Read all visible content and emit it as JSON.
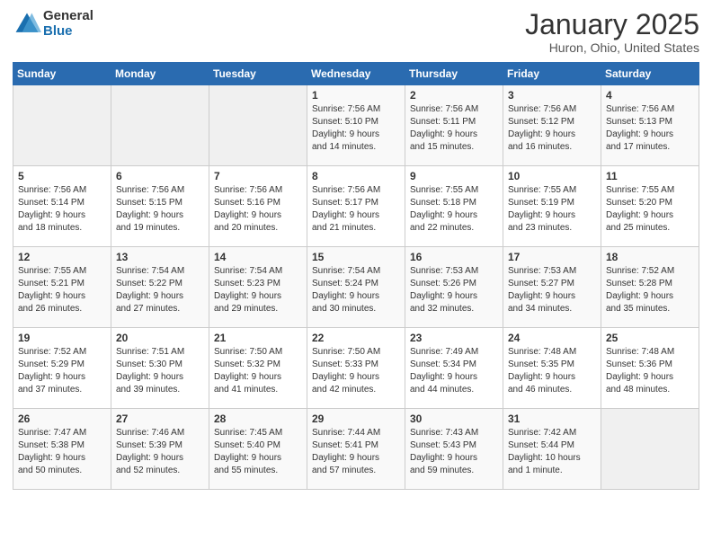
{
  "logo": {
    "general": "General",
    "blue": "Blue"
  },
  "header": {
    "month_year": "January 2025",
    "location": "Huron, Ohio, United States"
  },
  "weekdays": [
    "Sunday",
    "Monday",
    "Tuesday",
    "Wednesday",
    "Thursday",
    "Friday",
    "Saturday"
  ],
  "weeks": [
    [
      {
        "day": "",
        "detail": ""
      },
      {
        "day": "",
        "detail": ""
      },
      {
        "day": "",
        "detail": ""
      },
      {
        "day": "1",
        "detail": "Sunrise: 7:56 AM\nSunset: 5:10 PM\nDaylight: 9 hours\nand 14 minutes."
      },
      {
        "day": "2",
        "detail": "Sunrise: 7:56 AM\nSunset: 5:11 PM\nDaylight: 9 hours\nand 15 minutes."
      },
      {
        "day": "3",
        "detail": "Sunrise: 7:56 AM\nSunset: 5:12 PM\nDaylight: 9 hours\nand 16 minutes."
      },
      {
        "day": "4",
        "detail": "Sunrise: 7:56 AM\nSunset: 5:13 PM\nDaylight: 9 hours\nand 17 minutes."
      }
    ],
    [
      {
        "day": "5",
        "detail": "Sunrise: 7:56 AM\nSunset: 5:14 PM\nDaylight: 9 hours\nand 18 minutes."
      },
      {
        "day": "6",
        "detail": "Sunrise: 7:56 AM\nSunset: 5:15 PM\nDaylight: 9 hours\nand 19 minutes."
      },
      {
        "day": "7",
        "detail": "Sunrise: 7:56 AM\nSunset: 5:16 PM\nDaylight: 9 hours\nand 20 minutes."
      },
      {
        "day": "8",
        "detail": "Sunrise: 7:56 AM\nSunset: 5:17 PM\nDaylight: 9 hours\nand 21 minutes."
      },
      {
        "day": "9",
        "detail": "Sunrise: 7:55 AM\nSunset: 5:18 PM\nDaylight: 9 hours\nand 22 minutes."
      },
      {
        "day": "10",
        "detail": "Sunrise: 7:55 AM\nSunset: 5:19 PM\nDaylight: 9 hours\nand 23 minutes."
      },
      {
        "day": "11",
        "detail": "Sunrise: 7:55 AM\nSunset: 5:20 PM\nDaylight: 9 hours\nand 25 minutes."
      }
    ],
    [
      {
        "day": "12",
        "detail": "Sunrise: 7:55 AM\nSunset: 5:21 PM\nDaylight: 9 hours\nand 26 minutes."
      },
      {
        "day": "13",
        "detail": "Sunrise: 7:54 AM\nSunset: 5:22 PM\nDaylight: 9 hours\nand 27 minutes."
      },
      {
        "day": "14",
        "detail": "Sunrise: 7:54 AM\nSunset: 5:23 PM\nDaylight: 9 hours\nand 29 minutes."
      },
      {
        "day": "15",
        "detail": "Sunrise: 7:54 AM\nSunset: 5:24 PM\nDaylight: 9 hours\nand 30 minutes."
      },
      {
        "day": "16",
        "detail": "Sunrise: 7:53 AM\nSunset: 5:26 PM\nDaylight: 9 hours\nand 32 minutes."
      },
      {
        "day": "17",
        "detail": "Sunrise: 7:53 AM\nSunset: 5:27 PM\nDaylight: 9 hours\nand 34 minutes."
      },
      {
        "day": "18",
        "detail": "Sunrise: 7:52 AM\nSunset: 5:28 PM\nDaylight: 9 hours\nand 35 minutes."
      }
    ],
    [
      {
        "day": "19",
        "detail": "Sunrise: 7:52 AM\nSunset: 5:29 PM\nDaylight: 9 hours\nand 37 minutes."
      },
      {
        "day": "20",
        "detail": "Sunrise: 7:51 AM\nSunset: 5:30 PM\nDaylight: 9 hours\nand 39 minutes."
      },
      {
        "day": "21",
        "detail": "Sunrise: 7:50 AM\nSunset: 5:32 PM\nDaylight: 9 hours\nand 41 minutes."
      },
      {
        "day": "22",
        "detail": "Sunrise: 7:50 AM\nSunset: 5:33 PM\nDaylight: 9 hours\nand 42 minutes."
      },
      {
        "day": "23",
        "detail": "Sunrise: 7:49 AM\nSunset: 5:34 PM\nDaylight: 9 hours\nand 44 minutes."
      },
      {
        "day": "24",
        "detail": "Sunrise: 7:48 AM\nSunset: 5:35 PM\nDaylight: 9 hours\nand 46 minutes."
      },
      {
        "day": "25",
        "detail": "Sunrise: 7:48 AM\nSunset: 5:36 PM\nDaylight: 9 hours\nand 48 minutes."
      }
    ],
    [
      {
        "day": "26",
        "detail": "Sunrise: 7:47 AM\nSunset: 5:38 PM\nDaylight: 9 hours\nand 50 minutes."
      },
      {
        "day": "27",
        "detail": "Sunrise: 7:46 AM\nSunset: 5:39 PM\nDaylight: 9 hours\nand 52 minutes."
      },
      {
        "day": "28",
        "detail": "Sunrise: 7:45 AM\nSunset: 5:40 PM\nDaylight: 9 hours\nand 55 minutes."
      },
      {
        "day": "29",
        "detail": "Sunrise: 7:44 AM\nSunset: 5:41 PM\nDaylight: 9 hours\nand 57 minutes."
      },
      {
        "day": "30",
        "detail": "Sunrise: 7:43 AM\nSunset: 5:43 PM\nDaylight: 9 hours\nand 59 minutes."
      },
      {
        "day": "31",
        "detail": "Sunrise: 7:42 AM\nSunset: 5:44 PM\nDaylight: 10 hours\nand 1 minute."
      },
      {
        "day": "",
        "detail": ""
      }
    ]
  ]
}
